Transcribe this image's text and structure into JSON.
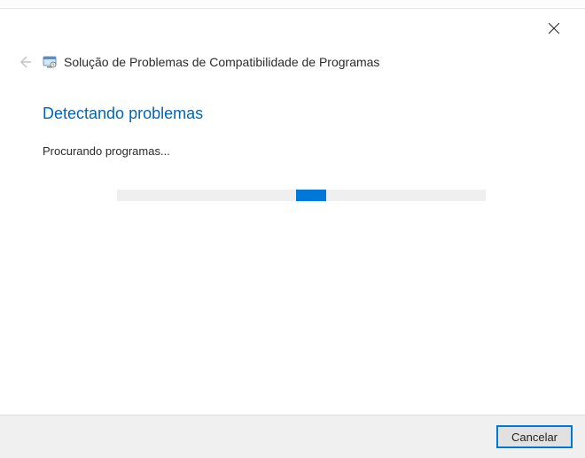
{
  "window": {
    "wizard_title": "Solução de Problemas de Compatibilidade de Programas"
  },
  "content": {
    "heading": "Detectando problemas",
    "status_text": "Procurando programas..."
  },
  "footer": {
    "cancel_label": "Cancelar"
  },
  "icons": {
    "close": "close-icon",
    "back": "back-arrow-icon",
    "app": "troubleshooter-icon"
  }
}
